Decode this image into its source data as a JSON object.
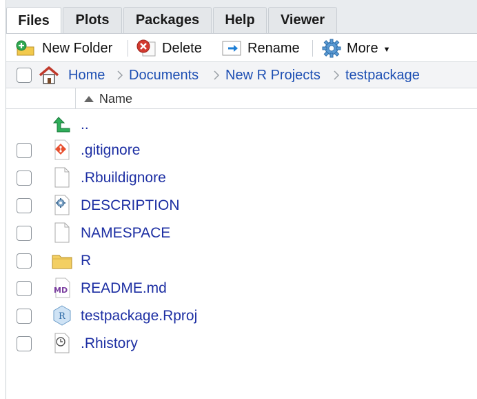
{
  "tabs": [
    {
      "label": "Files",
      "active": true
    },
    {
      "label": "Plots",
      "active": false
    },
    {
      "label": "Packages",
      "active": false
    },
    {
      "label": "Help",
      "active": false
    },
    {
      "label": "Viewer",
      "active": false
    }
  ],
  "toolbar": {
    "new_folder": "New Folder",
    "delete": "Delete",
    "rename": "Rename",
    "more": "More"
  },
  "breadcrumb": [
    "Home",
    "Documents",
    "New R Projects",
    "testpackage"
  ],
  "header": {
    "name": "Name",
    "sort": "ascending"
  },
  "files": [
    {
      "name": "..",
      "icon": "parent-directory-icon",
      "checkbox": false
    },
    {
      "name": ".gitignore",
      "icon": "git-icon",
      "checkbox": true
    },
    {
      "name": ".Rbuildignore",
      "icon": "blank-file-icon",
      "checkbox": true
    },
    {
      "name": "DESCRIPTION",
      "icon": "gear-file-icon",
      "checkbox": true
    },
    {
      "name": "NAMESPACE",
      "icon": "blank-file-icon",
      "checkbox": true
    },
    {
      "name": "R",
      "icon": "folder-icon",
      "checkbox": true
    },
    {
      "name": "README.md",
      "icon": "markdown-icon",
      "checkbox": true
    },
    {
      "name": "testpackage.Rproj",
      "icon": "rproj-icon",
      "checkbox": true
    },
    {
      "name": ".Rhistory",
      "icon": "history-file-icon",
      "checkbox": true
    }
  ],
  "colors": {
    "link": "#1d2fa3",
    "crumb": "#1d4fb3",
    "tabbar": "#e9ecef"
  }
}
